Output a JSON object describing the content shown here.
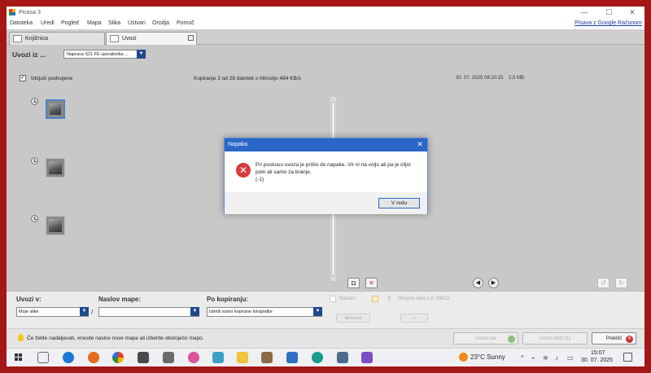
{
  "window": {
    "title": "Picasa 3",
    "controls": [
      "—",
      "☐",
      "✕"
    ]
  },
  "menu": {
    "items": [
      "Datoteka",
      "Uredi",
      "Pogled",
      "Mapa",
      "Slika",
      "Ustvari",
      "Orodja",
      "Pomoč"
    ],
    "google_link": "Pisava z Google Računom"
  },
  "tabs": [
    {
      "label": "Knjižnica"
    },
    {
      "label": "Uvozi"
    }
  ],
  "import": {
    "label": "Uvozi iz ...",
    "source": "Naprava S21 FE uporabnika ..."
  },
  "status": {
    "exclude_duplicates_label": "Izključi podvojene",
    "copy_progress": "Kopiranje 2 od 28 datotek s hitrostjo 484 KB/s",
    "date": "30. 07. 2025 08:10:15",
    "size": "2,5 MB"
  },
  "thumbnails": [
    {
      "selected": true
    },
    {
      "selected": false
    },
    {
      "selected": false
    }
  ],
  "bottom": {
    "import_to_label": "Uvozi v:",
    "import_to_value": "Moje slike",
    "folder_title_label": "Naslov mape:",
    "folder_title_value": "",
    "after_copy_label": "Po kopiranju:",
    "after_copy_value": "Izbriši samo kopirane fotografije",
    "settings_label": "Nastavi",
    "share_label": "Skupna raba z.n. NIKOr",
    "share_field": "Možnost",
    "add_field": "+ "
  },
  "actions": {
    "hint": "Če želite nadaljevati, vnesite naslov nove mape ali izberite obstoječo mapo.",
    "import_all": "Uvozi vse",
    "import_selected": "Uvozi izbor (1)",
    "cancel": "Prekliči"
  },
  "taskbar": {
    "weather": "23°C  Sunny",
    "time": "15:07",
    "date": "30. 07. 2025"
  },
  "dialog": {
    "title": "Napaka",
    "message": "Pri poskusu uvoza je prišlo do napake. Vir ni na voljo ali pa je ciljni poln ali samo za branje.",
    "code": "(-1)",
    "ok_label": "V redu"
  },
  "colors": {
    "frame": "#a51616",
    "dialog_titlebar": "#2b67c9",
    "error_icon": "#d83b3b",
    "dropdown": "#1e4a8c"
  }
}
